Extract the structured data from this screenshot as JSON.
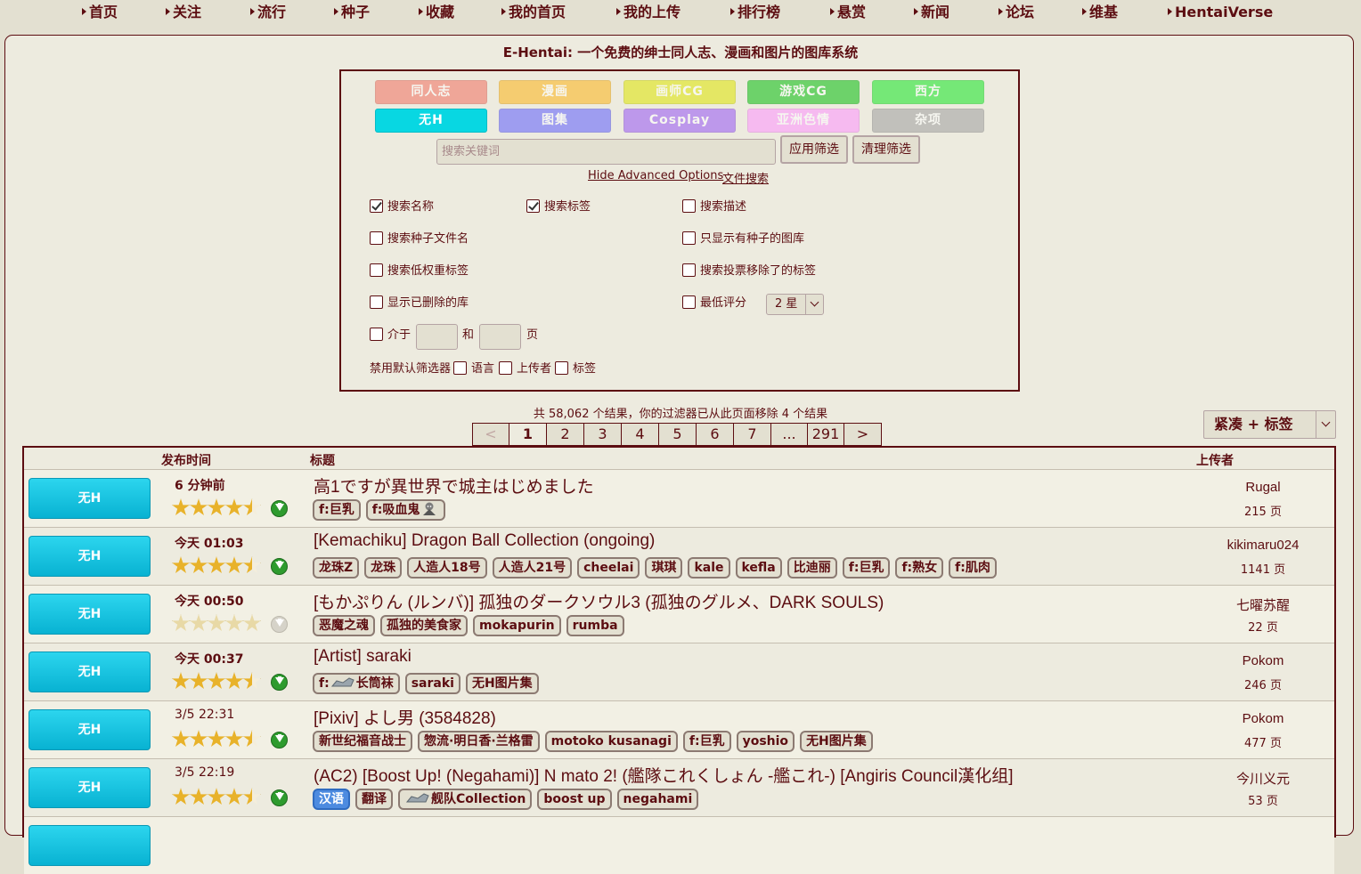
{
  "nav": [
    "首页",
    "关注",
    "流行",
    "种子",
    "收藏",
    "我的首页",
    "我的上传",
    "排行榜",
    "悬赏",
    "新闻",
    "论坛",
    "维基",
    "HentaiVerse"
  ],
  "site_title": "E-Hentai: 一个免费的绅士同人志、漫画和图片的图库系统",
  "categories": [
    {
      "label": "同人志",
      "color": "#F26F5F",
      "active": false
    },
    {
      "label": "漫画",
      "color": "#FCB417",
      "active": false
    },
    {
      "label": "画师CG",
      "color": "#DDE500",
      "active": false
    },
    {
      "label": "游戏CG",
      "color": "#05BF0B",
      "active": false
    },
    {
      "label": "西方",
      "color": "#14E723",
      "active": false
    },
    {
      "label": "无H",
      "color": "#08D7E2",
      "active": true
    },
    {
      "label": "图集",
      "color": "#5F5FFF",
      "active": false
    },
    {
      "label": "Cosplay",
      "color": "#9755F5",
      "active": false
    },
    {
      "label": "亚洲色情",
      "color": "#FE93FF",
      "active": false
    },
    {
      "label": "杂项",
      "color": "#9E9E9E",
      "active": false
    }
  ],
  "search": {
    "placeholder": "搜索关键词",
    "value": "",
    "apply_label": "应用筛选",
    "clear_label": "清理筛选",
    "advanced_link": "Hide Advanced Options",
    "file_search_link": "文件搜索"
  },
  "options": {
    "search_name": {
      "label": "搜索名称",
      "checked": true
    },
    "search_tags": {
      "label": "搜索标签",
      "checked": true
    },
    "search_desc": {
      "label": "搜索描述",
      "checked": false
    },
    "search_torrent": {
      "label": "搜索种子文件名",
      "checked": false
    },
    "only_torrent": {
      "label": "只显示有种子的图库",
      "checked": false
    },
    "low_power": {
      "label": "搜索低权重标签",
      "checked": false
    },
    "downvoted": {
      "label": "搜索投票移除了的标签",
      "checked": false
    },
    "expunged": {
      "label": "显示已删除的库",
      "checked": false
    },
    "min_rating": {
      "label": "最低评分",
      "checked": false,
      "value": "2 星"
    },
    "between": {
      "label": "介于",
      "and": "和",
      "pages": "页",
      "checked": false
    },
    "disable_filters": {
      "label": "禁用默认筛选器",
      "language": "语言",
      "uploader": "上传者",
      "tags": "标签"
    }
  },
  "results_info": "共 58,062 个结果，你的过滤器已从此页面移除 4 个结果",
  "pager": [
    "<",
    "1",
    "2",
    "3",
    "4",
    "5",
    "6",
    "7",
    "...",
    "291",
    ">"
  ],
  "pager_current": "1",
  "display_mode": "紧凑 + 标签",
  "table": {
    "headers": {
      "posted": "发布时间",
      "title": "标题",
      "uploader": "上传者"
    },
    "rows": [
      {
        "category": "无H",
        "posted": "6 分钟前",
        "bold_time": true,
        "rating": 4.5,
        "torrent": true,
        "title": "高1ですが異世界で城主はじめました",
        "tags": [
          {
            "t": "f:巨乳"
          },
          {
            "t": "f:吸血鬼",
            "icon": "vampire-icon"
          }
        ],
        "uploader": "Rugal",
        "pages": "215 页"
      },
      {
        "category": "无H",
        "posted": "今天 01:03",
        "bold_time": true,
        "rating": 4.5,
        "torrent": true,
        "title": "[Kemachiku] Dragon Ball Collection (ongoing)",
        "tags": [
          {
            "t": "龙珠Z"
          },
          {
            "t": "龙珠"
          },
          {
            "t": "人造人18号"
          },
          {
            "t": "人造人21号"
          },
          {
            "t": "cheelai"
          },
          {
            "t": "琪琪"
          },
          {
            "t": "kale"
          },
          {
            "t": "kefla"
          },
          {
            "t": "比迪丽"
          },
          {
            "t": "f:巨乳"
          },
          {
            "t": "f:熟女"
          },
          {
            "t": "f:肌肉"
          }
        ],
        "uploader": "kikimaru024",
        "pages": "1141 页"
      },
      {
        "category": "无H",
        "posted": "今天 00:50",
        "bold_time": true,
        "rating": 0,
        "torrent": false,
        "title": "[もかぷりん (ルンバ)] 孤独のダークソウル3 (孤独のグルメ、DARK SOULS)",
        "tags": [
          {
            "t": "恶魔之魂"
          },
          {
            "t": "孤独的美食家"
          },
          {
            "t": "mokapurin"
          },
          {
            "t": "rumba"
          }
        ],
        "uploader": "七曜苏醒",
        "pages": "22 页"
      },
      {
        "category": "无H",
        "posted": "今天 00:37",
        "bold_time": true,
        "rating": 4.5,
        "torrent": true,
        "title": "[Artist] saraki",
        "tags": [
          {
            "t": "长筒袜",
            "prefix": "f:",
            "icon": "stocking-icon"
          },
          {
            "t": "saraki"
          },
          {
            "t": "无H图片集"
          }
        ],
        "uploader": "Pokom",
        "pages": "246 页"
      },
      {
        "category": "无H",
        "posted": "3/5 22:31",
        "bold_time": false,
        "rating": 4.5,
        "torrent": true,
        "title": "[Pixiv] よし男 (3584828)",
        "tags": [
          {
            "t": "新世纪福音战士"
          },
          {
            "t": "惣流·明日香·兰格雷"
          },
          {
            "t": "motoko kusanagi"
          },
          {
            "t": "f:巨乳"
          },
          {
            "t": "yoshio"
          },
          {
            "t": "无H图片集"
          }
        ],
        "uploader": "Pokom",
        "pages": "477 页"
      },
      {
        "category": "无H",
        "posted": "3/5 22:19",
        "bold_time": false,
        "rating": 4.5,
        "torrent": true,
        "title": "(AC2) [Boost Up! (Negahami)] N mato 2! (艦隊これくしょん -艦これ-) [Angiris Council漢化组]",
        "tags": [
          {
            "t": "汉语",
            "lang": true
          },
          {
            "t": "翻译"
          },
          {
            "t": "舰队Collection",
            "icon": "ship-icon"
          },
          {
            "t": "boost up"
          },
          {
            "t": "negahami"
          }
        ],
        "uploader": "今川义元",
        "pages": "53 页"
      }
    ]
  }
}
